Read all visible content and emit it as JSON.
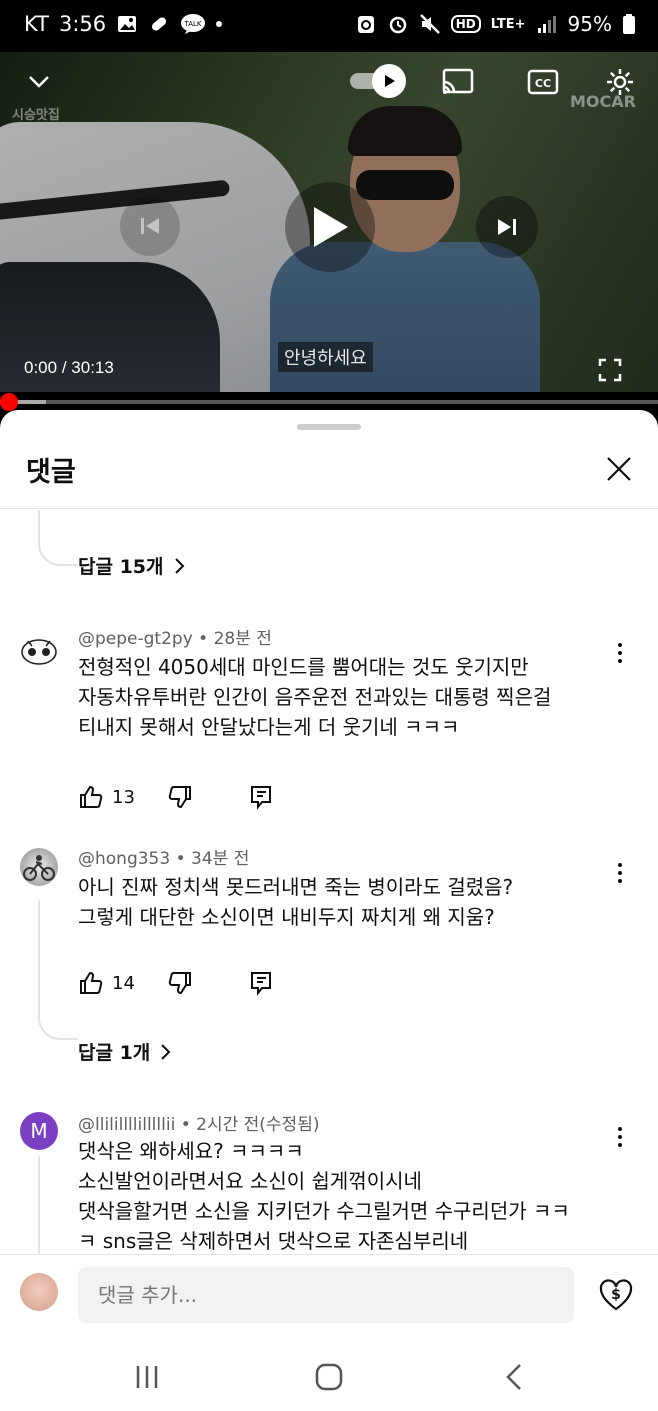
{
  "status_bar": {
    "carrier": "KT",
    "time": "3:56",
    "battery": "95%",
    "network": "LTE+",
    "hd_label": "HD"
  },
  "video": {
    "channel_watermark_left": "시승맛집",
    "channel_watermark_right": "MOCAR",
    "caption": "안녕하세요",
    "time_current": "0:00",
    "time_separator": "/",
    "time_total": "30:13",
    "progress_fraction": 0.07,
    "cc_label": "CC"
  },
  "comments_sheet": {
    "title": "댓글",
    "top_replies_label": "답글 15개",
    "comments": [
      {
        "author": "@pepe-gt2py",
        "age": "28분 전",
        "lines": [
          "전형적인 4050세대 마인드를 뿜어대는 것도 웃기지만",
          "자동차유투버란 인간이 음주운전 전과있는 대통령 찍은걸",
          "티내지 못해서 안달났다는게 더 웃기네 ㅋㅋㅋ"
        ],
        "likes": "13"
      },
      {
        "author": "@hong353",
        "age": "34분 전",
        "lines": [
          "아니 진짜 정치색 못드러내면 죽는 병이라도 걸렸음?",
          "그렇게 대단한 소신이면 내비두지 짜치게 왜 지움?"
        ],
        "likes": "14",
        "replies_label": "답글 1개"
      },
      {
        "author": "@llilillllilllllii",
        "age": "2시간 전(수정됨)",
        "avatar_letter": "M",
        "lines": [
          "댓삭은 왜하세요? ㅋㅋㅋㅋ",
          "소신발언이라면서요 소신이 쉽게꺾이시네",
          "댓삭을할거면 소신을 지키던가 수그릴거면 수구리던가 ㅋㅋ",
          "ㅋ sns글은 삭제하면서 댓삭으로 자존심부리네"
        ]
      }
    ],
    "meta_separator": "•",
    "composer_placeholder": "댓글 추가..."
  },
  "colors": {
    "progress_red": "#ff0000",
    "avatar_m": "#7b3fc4"
  },
  "icons": [
    "chevron-down-icon",
    "autoplay-toggle",
    "cast-icon",
    "cc-icon",
    "gear-icon",
    "previous-icon",
    "play-icon",
    "next-icon",
    "fullscreen-icon",
    "close-icon",
    "chevron-right-icon",
    "kebab-icon",
    "thumbs-up-icon",
    "thumbs-down-icon",
    "reply-icon",
    "super-thanks-icon",
    "recents-icon",
    "home-icon",
    "back-icon"
  ]
}
